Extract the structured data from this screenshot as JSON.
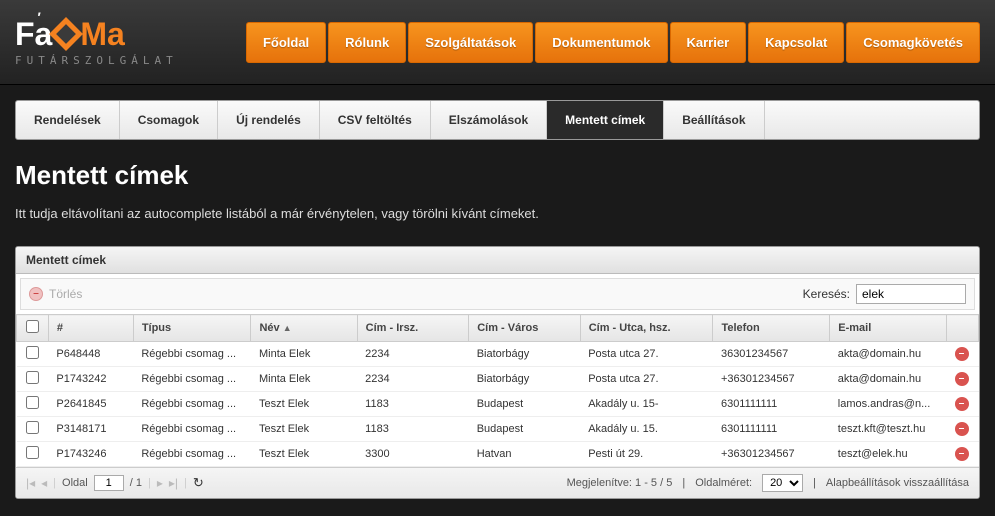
{
  "logo": {
    "sub": "Futárszolgálat"
  },
  "main_nav": [
    "Főoldal",
    "Rólunk",
    "Szolgáltatások",
    "Dokumentumok",
    "Karrier",
    "Kapcsolat",
    "Csomagkövetés"
  ],
  "sub_nav": {
    "items": [
      "Rendelések",
      "Csomagok",
      "Új rendelés",
      "CSV feltöltés",
      "Elszámolások",
      "Mentett címek",
      "Beállítások"
    ],
    "active": "Mentett címek"
  },
  "page": {
    "title": "Mentett címek",
    "desc": "Itt tudja eltávolítani az autocomplete listából a már érvénytelen, vagy törölni kívánt címeket."
  },
  "panel": {
    "title": "Mentett címek",
    "delete_label": "Törlés",
    "search_label": "Keresés:",
    "search_value": "elek"
  },
  "columns": {
    "id": "#",
    "type": "Típus",
    "name": "Név",
    "zip": "Cím - Irsz.",
    "city": "Cím - Város",
    "street": "Cím - Utca, hsz.",
    "phone": "Telefon",
    "email": "E-mail"
  },
  "rows": [
    {
      "id": "P648448",
      "type": "Régebbi csomag ...",
      "name": "Minta Elek",
      "zip": "2234",
      "city": "Biatorbágy",
      "street": "Posta utca 27.",
      "phone": "36301234567",
      "email": "akta@domain.hu"
    },
    {
      "id": "P1743242",
      "type": "Régebbi csomag ...",
      "name": "Minta Elek",
      "zip": "2234",
      "city": "Biatorbágy",
      "street": "Posta utca 27.",
      "phone": "+36301234567",
      "email": "akta@domain.hu"
    },
    {
      "id": "P2641845",
      "type": "Régebbi csomag ...",
      "name": "Teszt Elek",
      "zip": "1183",
      "city": "Budapest",
      "street": "Akadály u. 15-",
      "phone": "6301111111",
      "email": "lamos.andras@n..."
    },
    {
      "id": "P3148171",
      "type": "Régebbi csomag ...",
      "name": "Teszt Elek",
      "zip": "1183",
      "city": "Budapest",
      "street": "Akadály u. 15.",
      "phone": "6301111111",
      "email": "teszt.kft@teszt.hu"
    },
    {
      "id": "P1743246",
      "type": "Régebbi csomag ...",
      "name": "Teszt Elek",
      "zip": "3300",
      "city": "Hatvan",
      "street": "Pesti út 29.",
      "phone": "+36301234567",
      "email": "teszt@elek.hu"
    }
  ],
  "pager": {
    "page_label": "Oldal",
    "current": "1",
    "total": "/ 1",
    "display": "Megjelenítve: 1 - 5 / 5",
    "size_label": "Oldalméret:",
    "size_value": "20",
    "reset": "Alapbeállítások visszaállítása"
  }
}
